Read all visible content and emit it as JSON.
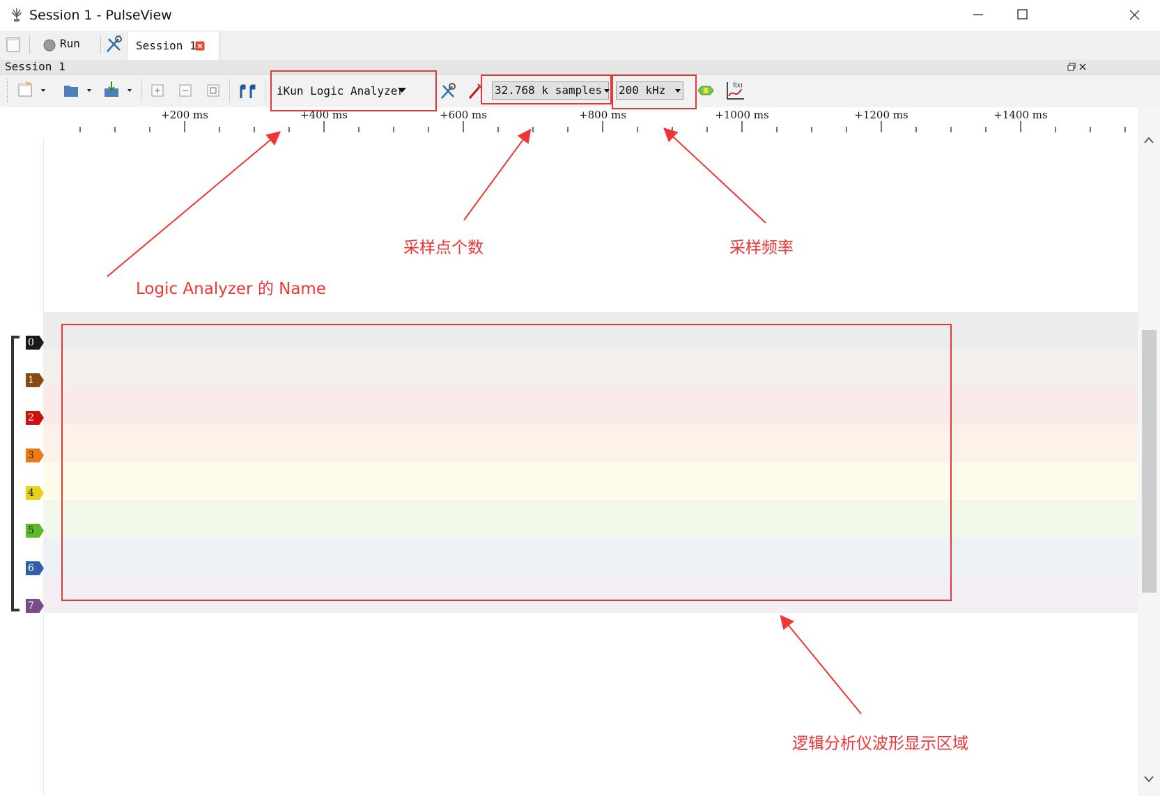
{
  "window": {
    "title": "Session 1 - PulseView",
    "minimize_icon": "minimize-icon",
    "maximize_icon": "maximize-icon",
    "close_icon": "close-icon"
  },
  "tabs": {
    "new_label": "",
    "run_label": "Run",
    "session_tab_label": "Session 1"
  },
  "session_bar": {
    "label": "Session 1"
  },
  "toolbar": {
    "device_name": "iKun Logic Analyzer",
    "sample_count": "32.768 k samples",
    "sample_rate": "200 kHz"
  },
  "ruler": {
    "labels": [
      "+200 ms",
      "+400 ms",
      "+600 ms",
      "+800 ms",
      "+1000 ms",
      "+1200 ms",
      "+1400 ms"
    ]
  },
  "channels": [
    {
      "label": "0",
      "color": "#1a1a1a",
      "lane": "#ececec"
    },
    {
      "label": "1",
      "color": "#8b4a13",
      "lane": "#f3f0ec"
    },
    {
      "label": "2",
      "color": "#cc1111",
      "lane": "#fbeaea"
    },
    {
      "label": "3",
      "color": "#ee7a14",
      "lane": "#fdf2ea"
    },
    {
      "label": "4",
      "color": "#e6d21a",
      "lane": "#fdfcea"
    },
    {
      "label": "5",
      "color": "#5fb82a",
      "lane": "#f2f8ea"
    },
    {
      "label": "6",
      "color": "#2f5fa8",
      "lane": "#eef1f6"
    },
    {
      "label": "7",
      "color": "#7a4c8a",
      "lane": "#f2eef4"
    }
  ],
  "annotations": {
    "name_label": "Logic Analyzer 的 Name",
    "samples_label": "采样点个数",
    "rate_label": "采样频率",
    "display_label": "逻辑分析仪波形显示区域"
  },
  "colors": {
    "annotation": "#ef3535"
  }
}
